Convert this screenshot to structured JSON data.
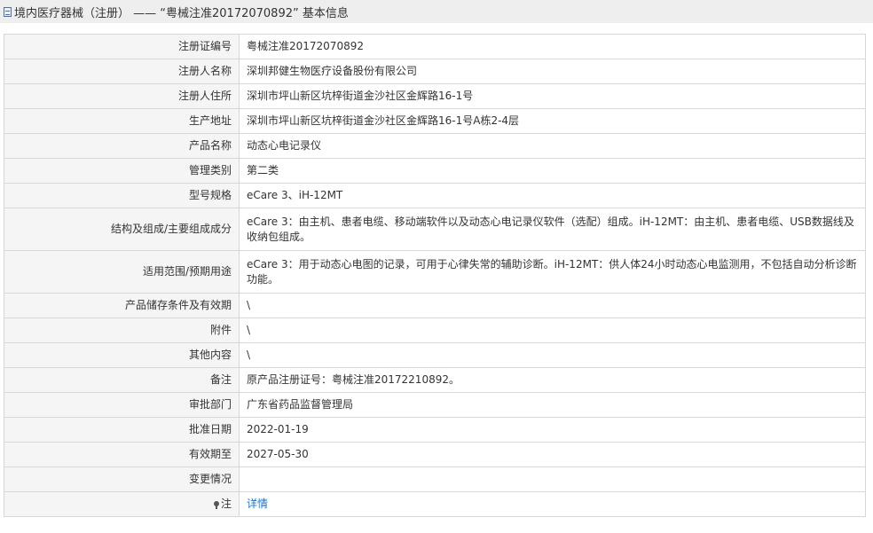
{
  "header": {
    "title": "境内医疗器械（注册） —— “粤械注准20172070892” 基本信息",
    "icon": "document-icon"
  },
  "rows": [
    {
      "label": "注册证编号",
      "value": "粤械注准20172070892"
    },
    {
      "label": "注册人名称",
      "value": "深圳邦健生物医疗设备股份有限公司"
    },
    {
      "label": "注册人住所",
      "value": "深圳市坪山新区坑梓街道金沙社区金辉路16-1号"
    },
    {
      "label": "生产地址",
      "value": "深圳市坪山新区坑梓街道金沙社区金辉路16-1号A栋2-4层"
    },
    {
      "label": "产品名称",
      "value": "动态心电记录仪"
    },
    {
      "label": "管理类别",
      "value": "第二类"
    },
    {
      "label": "型号规格",
      "value": "eCare 3、iH-12MT"
    },
    {
      "label": "结构及组成/主要组成成分",
      "value": "eCare 3：由主机、患者电缆、移动端软件以及动态心电记录仪软件（选配）组成。iH-12MT：由主机、患者电缆、USB数据线及收纳包组成。"
    },
    {
      "label": "适用范围/预期用途",
      "value": "eCare 3：用于动态心电图的记录，可用于心律失常的辅助诊断。iH-12MT：供人体24小时动态心电监测用，不包括自动分析诊断功能。"
    },
    {
      "label": "产品储存条件及有效期",
      "value": "\\"
    },
    {
      "label": "附件",
      "value": "\\"
    },
    {
      "label": "其他内容",
      "value": "\\"
    },
    {
      "label": "备注",
      "value": "原产品注册证号：粤械注准20172210892。"
    },
    {
      "label": "审批部门",
      "value": "广东省药品监督管理局"
    },
    {
      "label": "批准日期",
      "value": "2022-01-19"
    },
    {
      "label": "有效期至",
      "value": "2027-05-30"
    },
    {
      "label": "变更情况",
      "value": ""
    }
  ],
  "note": {
    "label": "注",
    "icon": "lightbulb-icon",
    "link_text": "详情",
    "link_color": "#1a74c9"
  }
}
